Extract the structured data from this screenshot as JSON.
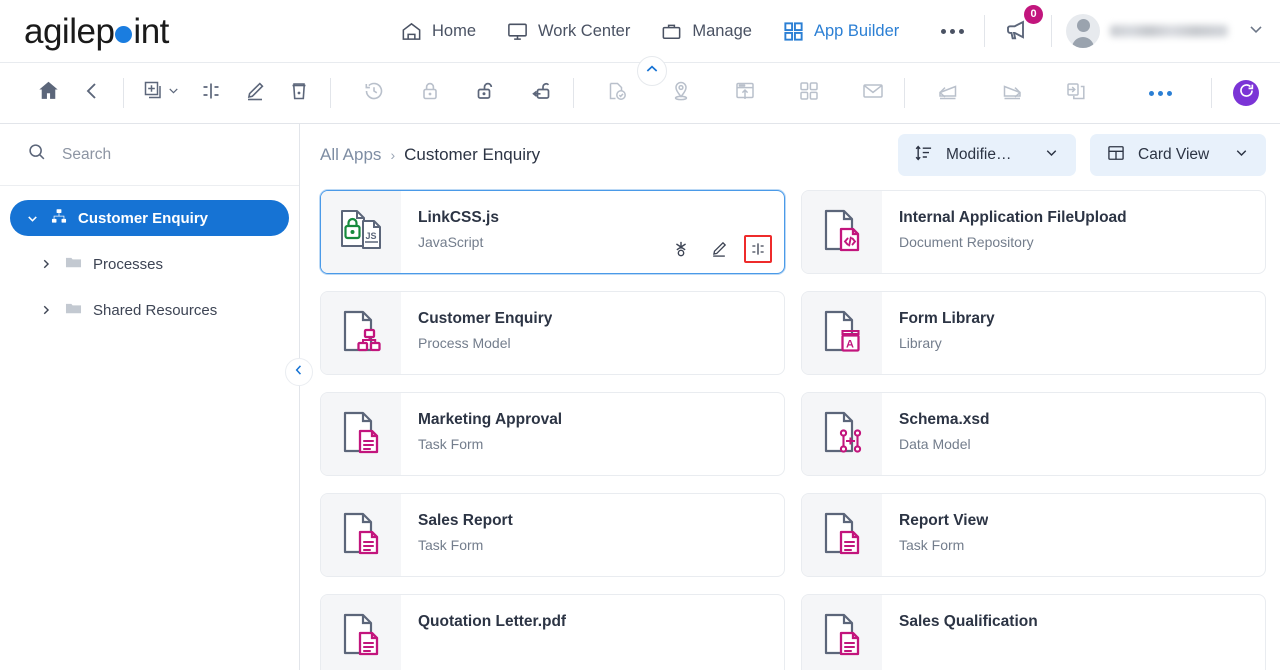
{
  "header": {
    "logo": {
      "text_before": "agilep",
      "text_after": "int",
      "dot_color": "#1a7de0"
    },
    "nav": [
      {
        "label": "Home",
        "icon": "home-icon",
        "active": false
      },
      {
        "label": "Work Center",
        "icon": "monitor-icon",
        "active": false
      },
      {
        "label": "Manage",
        "icon": "briefcase-icon",
        "active": false
      },
      {
        "label": "App Builder",
        "icon": "grid-icon",
        "active": true
      }
    ],
    "more_label": "more-options",
    "notification_count": "0",
    "notification_badge_color": "#c2157d",
    "user_menu": {
      "name": "",
      "avatar": "user-avatar"
    },
    "collapse_icon": "chevron-up-icon"
  },
  "toolbar": {
    "items": [
      {
        "name": "home-icon",
        "dim": false
      },
      {
        "name": "back-icon",
        "dim": false
      },
      {
        "name": "add-new-icon",
        "dim": false
      },
      {
        "name": "properties-icon",
        "dim": false
      },
      {
        "name": "edit-icon",
        "dim": false
      },
      {
        "name": "delete-icon",
        "dim": false
      },
      {
        "name": "history-icon",
        "dim": true
      },
      {
        "name": "lock-icon",
        "dim": true
      },
      {
        "name": "unlock-icon",
        "dim": false
      },
      {
        "name": "check-in-icon",
        "dim": false
      },
      {
        "name": "validate-document-icon",
        "dim": true
      },
      {
        "name": "location-pin-icon",
        "dim": true
      },
      {
        "name": "publish-icon",
        "dim": true
      },
      {
        "name": "apps-grid-icon",
        "dim": true
      },
      {
        "name": "email-icon",
        "dim": true
      },
      {
        "name": "import-icon",
        "dim": true
      },
      {
        "name": "export-icon",
        "dim": true
      },
      {
        "name": "migrate-icon",
        "dim": true
      }
    ],
    "more_label": "toolbar-more",
    "refresh_color": "#7b34d6"
  },
  "sidebar": {
    "search_placeholder": "Search",
    "tree": [
      {
        "label": "Customer Enquiry",
        "icon": "app-hierarchy-icon",
        "selected": true,
        "expanded": true,
        "level": 0
      },
      {
        "label": "Processes",
        "icon": "folder-icon",
        "selected": false,
        "expanded": false,
        "level": 1
      },
      {
        "label": "Shared Resources",
        "icon": "folder-icon",
        "selected": false,
        "expanded": false,
        "level": 1
      }
    ],
    "collapse_icon": "chevron-left-icon"
  },
  "content": {
    "breadcrumb": {
      "root": "All Apps",
      "separator": "›",
      "current": "Customer Enquiry"
    },
    "sort_button": {
      "label": "Modifie…",
      "icon": "sort-icon"
    },
    "view_button": {
      "label": "Card View",
      "icon": "card-view-icon"
    },
    "cards": [
      {
        "title": "LinkCSS.js",
        "subtitle": "JavaScript",
        "icon": "locked-js-file-icon",
        "selected": true,
        "actions": [
          {
            "name": "run-icon"
          },
          {
            "name": "edit-pencil-icon"
          },
          {
            "name": "attributes-icon",
            "highlighted": true
          }
        ]
      },
      {
        "title": "Internal Application FileUpload",
        "subtitle": "Document Repository",
        "icon": "code-file-icon",
        "selected": false,
        "actions": []
      },
      {
        "title": "Customer Enquiry",
        "subtitle": "Process Model",
        "icon": "process-model-file-icon",
        "selected": false,
        "actions": []
      },
      {
        "title": "Form Library",
        "subtitle": "Library",
        "icon": "library-file-icon",
        "selected": false,
        "actions": []
      },
      {
        "title": "Marketing Approval",
        "subtitle": "Task Form",
        "icon": "task-form-file-icon",
        "selected": false,
        "actions": []
      },
      {
        "title": "Schema.xsd",
        "subtitle": "Data Model",
        "icon": "data-model-file-icon",
        "selected": false,
        "actions": []
      },
      {
        "title": "Sales Report",
        "subtitle": "Task Form",
        "icon": "task-form-file-icon",
        "selected": false,
        "actions": []
      },
      {
        "title": "Report View",
        "subtitle": "Task Form",
        "icon": "task-form-file-icon",
        "selected": false,
        "actions": []
      },
      {
        "title": "Quotation Letter.pdf",
        "subtitle": "",
        "icon": "task-form-file-icon",
        "selected": false,
        "actions": []
      },
      {
        "title": "Sales Qualification",
        "subtitle": "",
        "icon": "task-form-file-icon",
        "selected": false,
        "actions": []
      }
    ]
  }
}
